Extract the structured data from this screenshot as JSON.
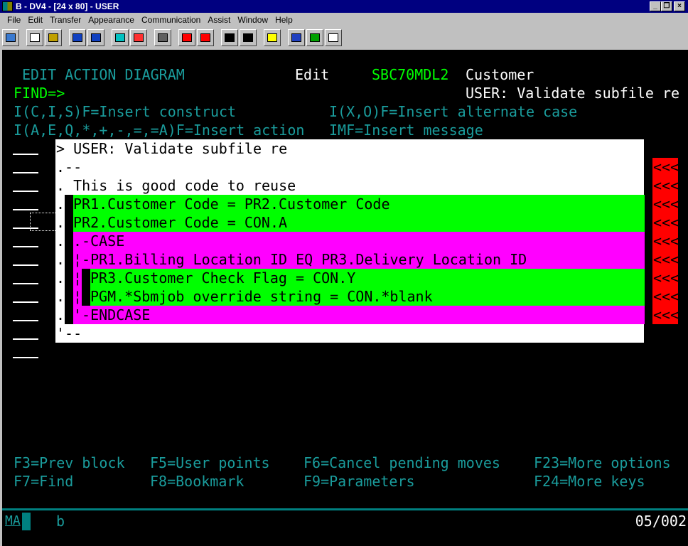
{
  "window": {
    "title": "B - DV4 - [24 x 80] - USER",
    "controls": [
      "_",
      "❐",
      "×"
    ]
  },
  "menu": [
    "File",
    "Edit",
    "Transfer",
    "Appearance",
    "Communication",
    "Assist",
    "Window",
    "Help"
  ],
  "toolbar": [
    {
      "icon": "print-icon",
      "color": "#3a7ad0"
    },
    {
      "icon": "copy-icon",
      "color": "#fff"
    },
    {
      "icon": "paste-icon",
      "color": "#c0a000"
    },
    {
      "icon": "send-file-icon",
      "color": "#1040c0"
    },
    {
      "icon": "receive-file-icon",
      "color": "#1040c0"
    },
    {
      "icon": "display-setup-icon",
      "color": "#00c0c0"
    },
    {
      "icon": "color-map-icon",
      "color": "#ff3030"
    },
    {
      "icon": "keyboard-map-icon",
      "color": "#606060"
    },
    {
      "icon": "record-macro-icon",
      "color": "#ff0000"
    },
    {
      "icon": "stop-macro-icon",
      "color": "#ff0000"
    },
    {
      "icon": "play-macro-icon",
      "color": "#000"
    },
    {
      "icon": "macro-icon",
      "color": "#000"
    },
    {
      "icon": "clipboard-icon",
      "color": "#ffff00"
    },
    {
      "icon": "globe-icon",
      "color": "#2040c0"
    },
    {
      "icon": "help-book-icon",
      "color": "#00a000"
    },
    {
      "icon": "popup-keypad-icon",
      "color": "#fff"
    }
  ],
  "header": {
    "title": "EDIT ACTION DIAGRAM",
    "mode": "Edit",
    "model": "SBC70MDL2",
    "file": "Customer",
    "find_label": "FIND=>",
    "function": "USER: Validate subfile re"
  },
  "hints": [
    "I(C,I,S)F=Insert construct",
    "I(X,O)F=Insert alternate case",
    "I(A,E,Q,*,+,-,=,=A)F=Insert action",
    "IMF=Insert message"
  ],
  "lines": [
    {
      "prefix": "",
      "text": "> USER: Validate subfile re",
      "style": "white"
    },
    {
      "prefix": "",
      "text": ".--",
      "style": "white"
    },
    {
      "prefix": "",
      "text": ". This is good code to reuse",
      "style": "white"
    },
    {
      "prefix": ".",
      "text": "PR1.Customer Code = PR2.Customer Code",
      "style": "green"
    },
    {
      "prefix": ".",
      "text": "PR2.Customer Code = CON.A",
      "style": "green"
    },
    {
      "prefix": ".",
      "text": ".-CASE",
      "style": "magenta"
    },
    {
      "prefix": ".",
      "text": "¦-PR1.Billing Location ID EQ PR3.Delivery Location ID",
      "style": "magenta"
    },
    {
      "prefix": ".",
      "lead": "¦",
      "text": "PR3.Customer Check Flag = CON.Y",
      "style": "nested"
    },
    {
      "prefix": ".",
      "lead": "¦",
      "text": "PGM.*Sbmjob override string = CON.*blank",
      "style": "nested"
    },
    {
      "prefix": ".",
      "text": "'-ENDCASE",
      "style": "magenta"
    },
    {
      "prefix": "",
      "text": "'--",
      "style": "white"
    }
  ],
  "markers": [
    "<<<",
    "<<<",
    "<<<",
    "<<<",
    "<<<",
    "<<<",
    "<<<",
    "<<<",
    "<<<"
  ],
  "fkeys": [
    [
      "F3=Prev block",
      "F5=User points",
      "F6=Cancel pending moves",
      "F23=More options"
    ],
    [
      "F7=Find",
      "F8=Bookmark",
      "F9=Parameters",
      "F24=More keys"
    ]
  ],
  "status": {
    "mode": "MA",
    "input": "b",
    "cursor_pos": "05/002"
  },
  "colors": {
    "green": "#00ff00",
    "magenta": "#ff00ff",
    "red": "#ff0000",
    "teal": "#1a9c9c"
  }
}
